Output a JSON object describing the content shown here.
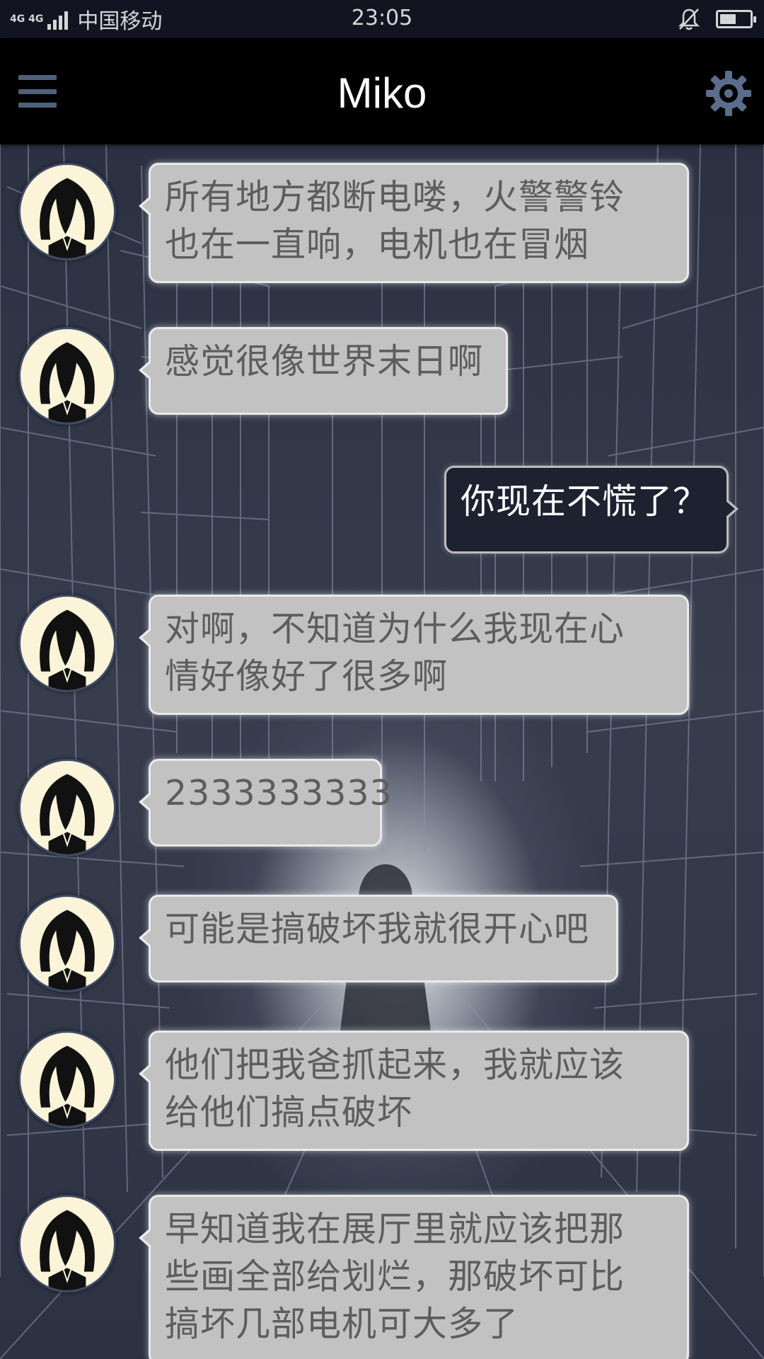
{
  "status_bar": {
    "network_label": "4G 4G",
    "carrier": "中国移动",
    "time": "23:05",
    "battery_level": 0.55,
    "icons": [
      "signal-icon",
      "bell-muted-icon",
      "battery-icon"
    ]
  },
  "header": {
    "title": "Miko",
    "menu_icon": "hamburger-menu-icon",
    "settings_icon": "gear-icon"
  },
  "colors": {
    "header_bg": "#000000",
    "incoming_bubble": "#c2c2c2",
    "incoming_text": "#5d5d5d",
    "outgoing_bubble": "#1d2130",
    "outgoing_text": "#ffffff",
    "avatar_bg": "#fbf4d8"
  },
  "messages": [
    {
      "sender": "incoming",
      "lines": [
        "所有地方都断电喽，火警警铃",
        "也在一直响，电机也在冒烟"
      ]
    },
    {
      "sender": "incoming",
      "lines": [
        "感觉很像世界末日啊"
      ]
    },
    {
      "sender": "outgoing",
      "lines": [
        "你现在不慌了？"
      ]
    },
    {
      "sender": "incoming",
      "lines": [
        "对啊，不知道为什么我现在心",
        "情好像好了很多啊"
      ]
    },
    {
      "sender": "incoming",
      "lines": [
        "2333333333"
      ]
    },
    {
      "sender": "incoming",
      "lines": [
        "可能是搞破坏我就很开心吧"
      ]
    },
    {
      "sender": "incoming",
      "lines": [
        "他们把我爸抓起来，我就应该",
        "给他们搞点破坏"
      ]
    },
    {
      "sender": "incoming",
      "lines": [
        "早知道我在展厅里就应该把那",
        "些画全部给划烂，那破坏可比",
        "搞坏几部电机可大多了"
      ]
    }
  ]
}
